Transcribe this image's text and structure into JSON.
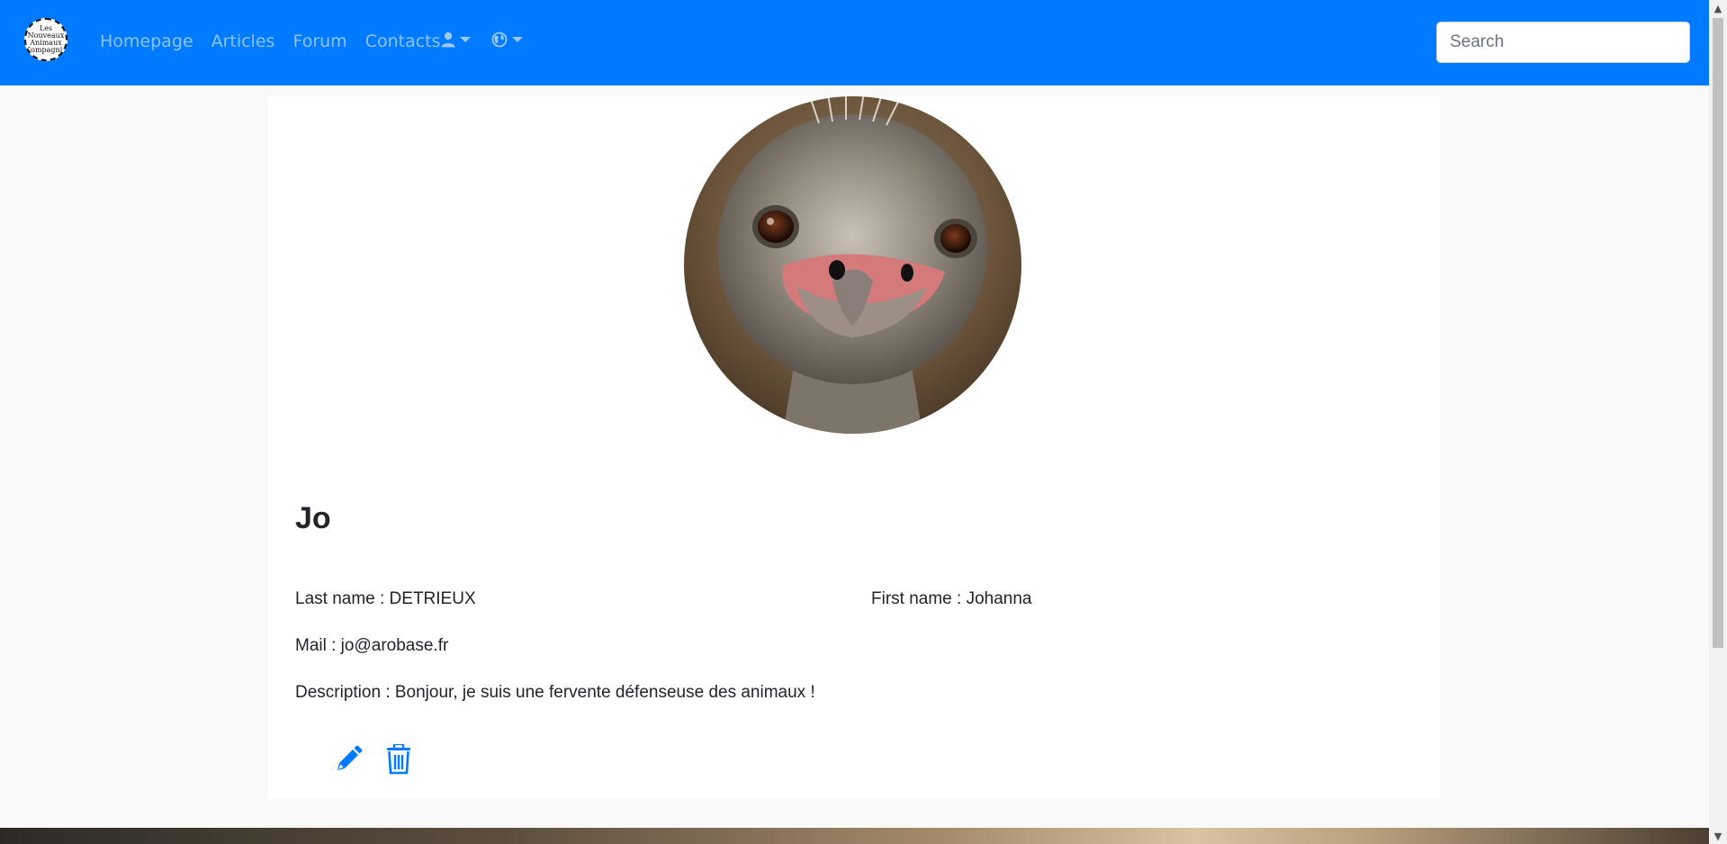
{
  "nav": {
    "logo_lines": [
      "Les",
      "Nouveaux",
      "Animaux",
      "Compagnie"
    ],
    "links": [
      "Homepage",
      "Articles",
      "Forum",
      "Contacts"
    ],
    "search_placeholder": "Search",
    "user_menu_icon": "user-icon",
    "language_menu_icon": "globe-icon"
  },
  "profile": {
    "avatar_icon": "ostrich-photo",
    "username": "Jo",
    "last_name": "Last name : DETRIEUX",
    "first_name": "First name : Johanna",
    "mail": "Mail : jo@arobase.fr",
    "description": "Description : Bonjour, je suis une fervente défenseuse des animaux !",
    "edit_icon": "pencil-icon",
    "delete_icon": "trash-icon"
  },
  "colors": {
    "navbar": "#007bff",
    "accent_icon": "#007bff",
    "page_bg": "#f9f9f9"
  }
}
